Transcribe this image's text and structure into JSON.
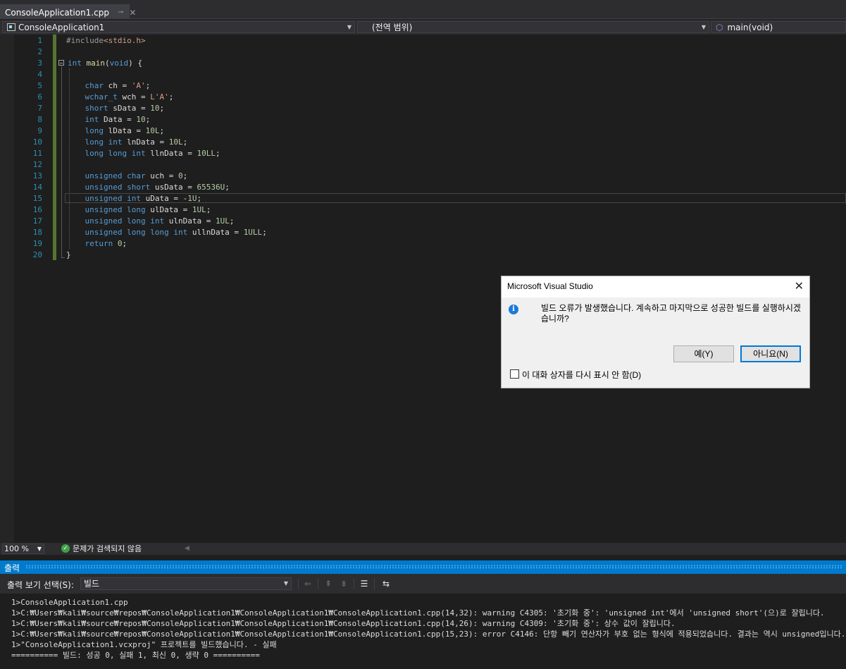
{
  "tab": {
    "filename": "ConsoleApplication1.cpp",
    "pin_glyph": "⊸",
    "close_glyph": "✕"
  },
  "navbar": {
    "project": "ConsoleApplication1",
    "scope": "(전역 범위)",
    "member": "main(void)"
  },
  "editor": {
    "line_numbers": [
      "1",
      "2",
      "3",
      "4",
      "5",
      "6",
      "7",
      "8",
      "9",
      "10",
      "11",
      "12",
      "13",
      "14",
      "15",
      "16",
      "17",
      "18",
      "19",
      "20"
    ],
    "lines": [
      [
        {
          "t": "#include",
          "c": "pp"
        },
        {
          "t": "<stdio.h>",
          "c": "inc"
        }
      ],
      [],
      [
        {
          "t": "int",
          "c": "kw"
        },
        {
          "t": " "
        },
        {
          "t": "main",
          "c": "fn"
        },
        {
          "t": "("
        },
        {
          "t": "void",
          "c": "kw"
        },
        {
          "t": ") {"
        }
      ],
      [],
      [
        {
          "t": "    "
        },
        {
          "t": "char",
          "c": "kw"
        },
        {
          "t": " ch = "
        },
        {
          "t": "'A'",
          "c": "str"
        },
        {
          "t": ";"
        }
      ],
      [
        {
          "t": "    "
        },
        {
          "t": "wchar_t",
          "c": "kw"
        },
        {
          "t": " wch = "
        },
        {
          "t": "L'A'",
          "c": "str"
        },
        {
          "t": ";"
        }
      ],
      [
        {
          "t": "    "
        },
        {
          "t": "short",
          "c": "kw"
        },
        {
          "t": " sData = "
        },
        {
          "t": "10",
          "c": "num"
        },
        {
          "t": ";"
        }
      ],
      [
        {
          "t": "    "
        },
        {
          "t": "int",
          "c": "kw"
        },
        {
          "t": " Data = "
        },
        {
          "t": "10",
          "c": "num"
        },
        {
          "t": ";"
        }
      ],
      [
        {
          "t": "    "
        },
        {
          "t": "long",
          "c": "kw"
        },
        {
          "t": " lData = "
        },
        {
          "t": "10L",
          "c": "num"
        },
        {
          "t": ";"
        }
      ],
      [
        {
          "t": "    "
        },
        {
          "t": "long int",
          "c": "kw"
        },
        {
          "t": " lnData = "
        },
        {
          "t": "10L",
          "c": "num"
        },
        {
          "t": ";"
        }
      ],
      [
        {
          "t": "    "
        },
        {
          "t": "long long int",
          "c": "kw"
        },
        {
          "t": " llnData = "
        },
        {
          "t": "10LL",
          "c": "num"
        },
        {
          "t": ";"
        }
      ],
      [],
      [
        {
          "t": "    "
        },
        {
          "t": "unsigned char",
          "c": "kw"
        },
        {
          "t": " uch = "
        },
        {
          "t": "0",
          "c": "num"
        },
        {
          "t": ";"
        }
      ],
      [
        {
          "t": "    "
        },
        {
          "t": "unsigned short",
          "c": "kw"
        },
        {
          "t": " usData = "
        },
        {
          "t": "65536U",
          "c": "num"
        },
        {
          "t": ";"
        }
      ],
      [
        {
          "t": "    "
        },
        {
          "t": "unsigned int",
          "c": "kw"
        },
        {
          "t": " uData = -"
        },
        {
          "t": "1U",
          "c": "num"
        },
        {
          "t": ";"
        }
      ],
      [
        {
          "t": "    "
        },
        {
          "t": "unsigned long",
          "c": "kw"
        },
        {
          "t": " ulData = "
        },
        {
          "t": "1UL",
          "c": "num"
        },
        {
          "t": ";"
        }
      ],
      [
        {
          "t": "    "
        },
        {
          "t": "unsigned long int",
          "c": "kw"
        },
        {
          "t": " ulnData = "
        },
        {
          "t": "1UL",
          "c": "num"
        },
        {
          "t": ";"
        }
      ],
      [
        {
          "t": "    "
        },
        {
          "t": "unsigned long long int",
          "c": "kw"
        },
        {
          "t": " ullnData = "
        },
        {
          "t": "1ULL",
          "c": "num"
        },
        {
          "t": ";"
        }
      ],
      [
        {
          "t": "    "
        },
        {
          "t": "return",
          "c": "kw"
        },
        {
          "t": " "
        },
        {
          "t": "0",
          "c": "num"
        },
        {
          "t": ";"
        }
      ],
      [
        {
          "t": "}"
        }
      ]
    ]
  },
  "status": {
    "zoom": "100 %",
    "issues": "문제가 검색되지 않음"
  },
  "output": {
    "title": "출력",
    "source_label": "출력 보기 선택(S):",
    "source_value": "빌드",
    "lines": [
      "1>ConsoleApplication1.cpp",
      "1>C:₩Users₩kali₩source₩repos₩ConsoleApplication1₩ConsoleApplication1₩ConsoleApplication1.cpp(14,32): warning C4305: '초기화 중': 'unsigned int'에서 'unsigned short'(으)로 잘립니다.",
      "1>C:₩Users₩kali₩source₩repos₩ConsoleApplication1₩ConsoleApplication1₩ConsoleApplication1.cpp(14,26): warning C4309: '초기화 중': 상수 값이 잘립니다.",
      "1>C:₩Users₩kali₩source₩repos₩ConsoleApplication1₩ConsoleApplication1₩ConsoleApplication1.cpp(15,23): error C4146: 단항 빼기 연산자가 부호 없는 형식에 적용되었습니다. 결과는 역시 unsigned입니다.",
      "1>\"ConsoleApplication1.vcxproj\" 프로젝트를 빌드했습니다. - 실패",
      "========== 빌드: 성공 0, 실패 1, 최신 0, 생략 0 =========="
    ]
  },
  "dialog": {
    "title": "Microsoft Visual Studio",
    "message": "빌드 오류가 발생했습니다. 계속하고 마지막으로 성공한 빌드를 실행하시겠습니까?",
    "yes": "예(Y)",
    "no": "아니요(N)",
    "dont_show": "이 대화 상자를 다시 표시 안 함(D)"
  }
}
